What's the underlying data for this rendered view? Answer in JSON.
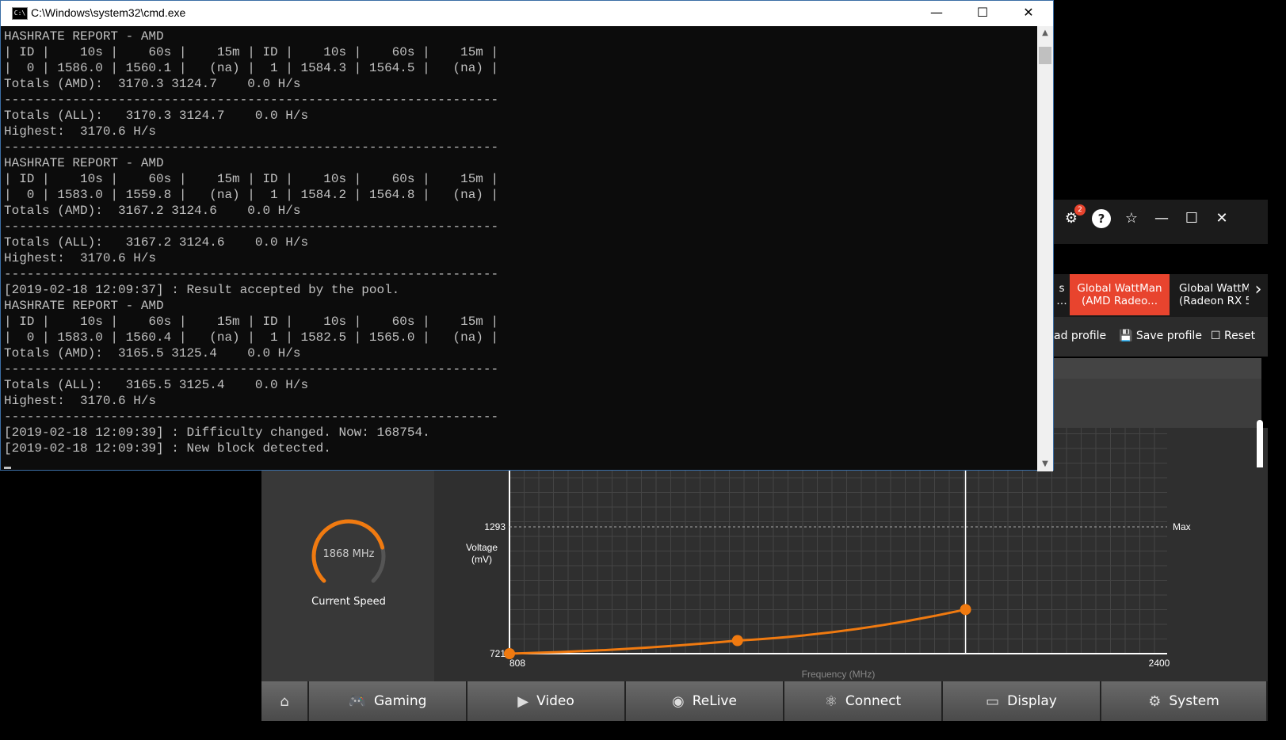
{
  "cmd": {
    "title": "C:\\Windows\\system32\\cmd.exe",
    "icon_label": "C:\\",
    "controls": {
      "minimize": "—",
      "maximize": "☐",
      "close": "✕"
    },
    "lines": [
      "HASHRATE REPORT - AMD",
      "| ID |    10s |    60s |    15m | ID |    10s |    60s |    15m |",
      "|  0 | 1586.0 | 1560.1 |   (na) |  1 | 1584.3 | 1564.5 |   (na) |",
      "Totals (AMD):  3170.3 3124.7    0.0 H/s",
      "-----------------------------------------------------------------",
      "Totals (ALL):   3170.3 3124.7    0.0 H/s",
      "Highest:  3170.6 H/s",
      "-----------------------------------------------------------------",
      "HASHRATE REPORT - AMD",
      "| ID |    10s |    60s |    15m | ID |    10s |    60s |    15m |",
      "|  0 | 1583.0 | 1559.8 |   (na) |  1 | 1584.2 | 1564.8 |   (na) |",
      "Totals (AMD):  3167.2 3124.6    0.0 H/s",
      "-----------------------------------------------------------------",
      "Totals (ALL):   3167.2 3124.6    0.0 H/s",
      "Highest:  3170.6 H/s",
      "-----------------------------------------------------------------",
      "[2019-02-18 12:09:37] : Result accepted by the pool.",
      "HASHRATE REPORT - AMD",
      "| ID |    10s |    60s |    15m | ID |    10s |    60s |    15m |",
      "|  0 | 1583.0 | 1560.4 |   (na) |  1 | 1582.5 | 1565.0 |   (na) |",
      "Totals (AMD):  3165.5 3125.4    0.0 H/s",
      "-----------------------------------------------------------------",
      "Totals (ALL):   3165.5 3125.4    0.0 H/s",
      "Highest:  3170.6 H/s",
      "-----------------------------------------------------------------",
      "[2019-02-18 12:09:39] : Difficulty changed. Now: 168754.",
      "[2019-02-18 12:09:39] : New block detected."
    ]
  },
  "radeon": {
    "header_icons": [
      {
        "name": "notifications-icon",
        "glyph": "⚙",
        "badge": "2"
      },
      {
        "name": "help-icon",
        "glyph": "?"
      },
      {
        "name": "favorite-icon",
        "glyph": "☆"
      },
      {
        "name": "minimize-icon",
        "glyph": "—"
      },
      {
        "name": "maximize-icon",
        "glyph": "☐"
      },
      {
        "name": "close-icon",
        "glyph": "✕"
      }
    ],
    "tabs": {
      "partial_left": "s\n…",
      "active": "Global WattMan\n(AMD Radeo...",
      "next": "Global WattM\n(Radeon RX 5",
      "next_arrow": "›"
    },
    "toolbar": {
      "load_profile": "ad profile",
      "save_profile": "Save profile",
      "reset": "Reset"
    },
    "speed": {
      "value": "1868 MHz",
      "label": "Current Speed",
      "gauge_fraction": 0.78
    },
    "colors": {
      "accent": "#e8442e",
      "curve": "#f07a10"
    },
    "bottom_nav": [
      {
        "name": "home",
        "label": "",
        "icon": "⌂"
      },
      {
        "name": "gaming",
        "label": "Gaming",
        "icon": "🎮"
      },
      {
        "name": "video",
        "label": "Video",
        "icon": "▶"
      },
      {
        "name": "relive",
        "label": "ReLive",
        "icon": "◉"
      },
      {
        "name": "connect",
        "label": "Connect",
        "icon": "⚛"
      },
      {
        "name": "display",
        "label": "Display",
        "icon": "▭"
      },
      {
        "name": "system",
        "label": "System",
        "icon": "⚙"
      }
    ]
  },
  "chart_data": {
    "type": "line",
    "ylabel": "Voltage\n(mV)",
    "xlabel": "Frequency (MHz)",
    "y_tick_labels": [
      "721",
      "1293"
    ],
    "x_tick_labels": [
      "808",
      "2400"
    ],
    "max_label": "Max",
    "xlim": [
      808,
      2400
    ],
    "ylim": [
      721,
      1293
    ],
    "grid": true,
    "series": [
      {
        "x": [
          808,
          1360,
          1912
        ],
        "y": [
          721,
          780,
          920
        ]
      }
    ],
    "reference_x": 1912
  }
}
